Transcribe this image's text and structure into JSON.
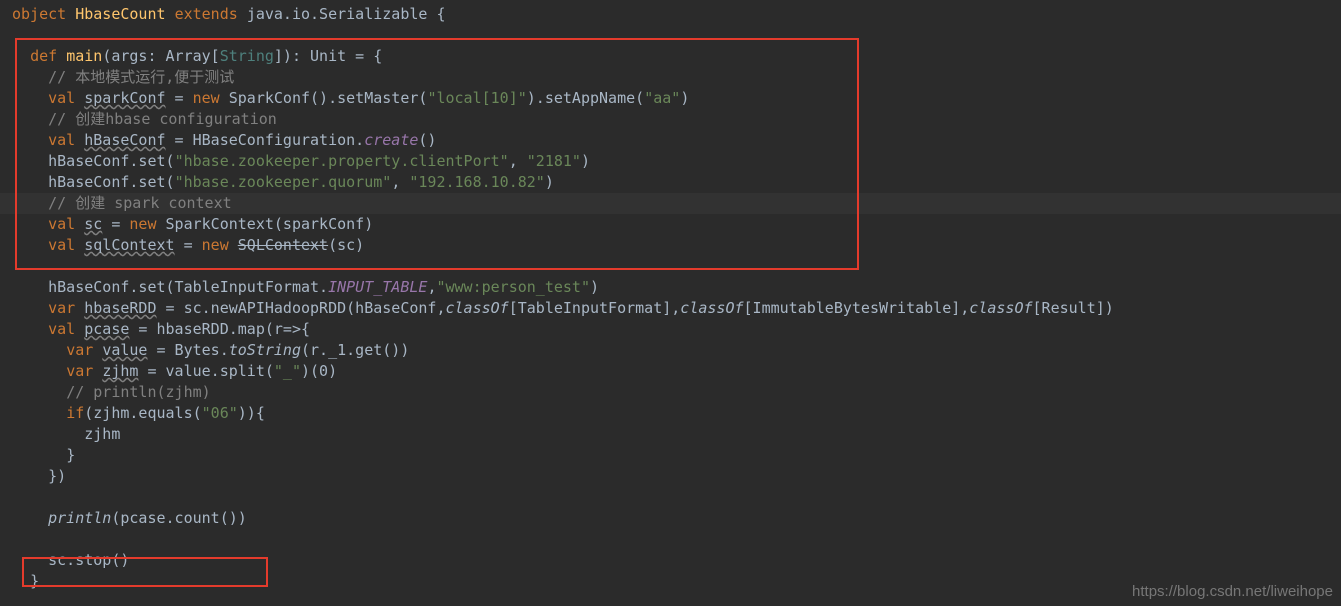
{
  "code": {
    "l0_object": "object",
    "l0_name": "HbaseCount",
    "l0_extends": "extends",
    "l0_super": "java.io.Serializable {",
    "l2_def": "def",
    "l2_main": "main",
    "l2_sig_open": "(args: Array[",
    "l2_string": "String",
    "l2_sig_close": "]): Unit = {",
    "l3_cmt": "// 本地模式运行,便于测试",
    "l4_val": "val",
    "l4_name": "sparkConf",
    "l4_eq": " = ",
    "l4_new": "new",
    "l4_rest1": " SparkConf().setMaster(",
    "l4_str1": "\"local[10]\"",
    "l4_rest2": ").setAppName(",
    "l4_str2": "\"aa\"",
    "l4_rest3": ")",
    "l5_cmt": "// 创建hbase configuration",
    "l6_val": "val",
    "l6_name": "hBaseConf",
    "l6_eq": " = HBaseConfiguration.",
    "l6_create": "create",
    "l6_close": "()",
    "l7_pre": "hBaseConf.set(",
    "l7_s1": "\"hbase.zookeeper.property.clientPort\"",
    "l7_c": ", ",
    "l7_s2": "\"2181\"",
    "l7_close": ")",
    "l8_pre": "hBaseConf.set(",
    "l8_s1": "\"hbase.zookeeper.quorum\"",
    "l8_c": ", ",
    "l8_s2": "\"192.168.10.82\"",
    "l8_close": ")",
    "l9_cmt": "// 创建 spark context",
    "l10_val": "val",
    "l10_name": "sc",
    "l10_eq": " = ",
    "l10_new": "new",
    "l10_rest": " SparkContext(sparkConf)",
    "l11_val": "val",
    "l11_name": "sqlContext",
    "l11_eq": " = ",
    "l11_new": "new",
    "l11_sql": "SQLContext",
    "l11_close": "(sc)",
    "l13_pre": "hBaseConf.set(TableInputFormat.",
    "l13_it": "INPUT_TABLE",
    "l13_c": ",",
    "l13_s": "\"www:person_test\"",
    "l13_close": ")",
    "l14_var": "var",
    "l14_name": "hbaseRDD",
    "l14_eq": " = sc.newAPIHadoopRDD(hBaseConf,",
    "l14_co1": "classOf",
    "l14_t1": "[TableInputFormat],",
    "l14_co2": "classOf",
    "l14_t2": "[ImmutableBytesWritable],",
    "l14_co3": "classOf",
    "l14_t3": "[Result])",
    "l15_val": "val",
    "l15_name": "pcase",
    "l15_eq": " = hbaseRDD.map(r=>{",
    "l16_var": "var",
    "l16_name": "value",
    "l16_eq": " = Bytes.",
    "l16_ts": "toString",
    "l16_close": "(r._1.get())",
    "l17_var": "var",
    "l17_name": "zjhm",
    "l17_eq": " = value.split(",
    "l17_s": "\"_\"",
    "l17_close": ")(0)",
    "l18_cmt": "// println(zjhm)",
    "l19_if": "if",
    "l19_open": "(zjhm.equals(",
    "l19_s": "\"06\"",
    "l19_close": ")){",
    "l20": "zjhm",
    "l21": "}",
    "l22": "})",
    "l24_pr": "println",
    "l24_rest": "(pcase.count())",
    "l26": "sc.stop()",
    "l27": "}"
  },
  "watermark": "https://blog.csdn.net/liweihope"
}
